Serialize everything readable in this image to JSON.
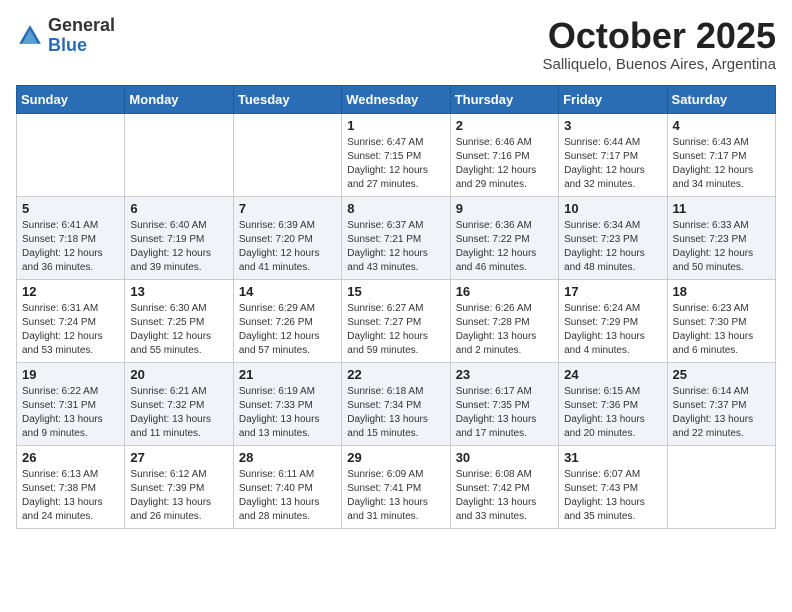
{
  "logo": {
    "general": "General",
    "blue": "Blue"
  },
  "title": "October 2025",
  "subtitle": "Salliquelo, Buenos Aires, Argentina",
  "days_header": [
    "Sunday",
    "Monday",
    "Tuesday",
    "Wednesday",
    "Thursday",
    "Friday",
    "Saturday"
  ],
  "weeks": [
    [
      {
        "day": "",
        "info": ""
      },
      {
        "day": "",
        "info": ""
      },
      {
        "day": "",
        "info": ""
      },
      {
        "day": "1",
        "info": "Sunrise: 6:47 AM\nSunset: 7:15 PM\nDaylight: 12 hours\nand 27 minutes."
      },
      {
        "day": "2",
        "info": "Sunrise: 6:46 AM\nSunset: 7:16 PM\nDaylight: 12 hours\nand 29 minutes."
      },
      {
        "day": "3",
        "info": "Sunrise: 6:44 AM\nSunset: 7:17 PM\nDaylight: 12 hours\nand 32 minutes."
      },
      {
        "day": "4",
        "info": "Sunrise: 6:43 AM\nSunset: 7:17 PM\nDaylight: 12 hours\nand 34 minutes."
      }
    ],
    [
      {
        "day": "5",
        "info": "Sunrise: 6:41 AM\nSunset: 7:18 PM\nDaylight: 12 hours\nand 36 minutes."
      },
      {
        "day": "6",
        "info": "Sunrise: 6:40 AM\nSunset: 7:19 PM\nDaylight: 12 hours\nand 39 minutes."
      },
      {
        "day": "7",
        "info": "Sunrise: 6:39 AM\nSunset: 7:20 PM\nDaylight: 12 hours\nand 41 minutes."
      },
      {
        "day": "8",
        "info": "Sunrise: 6:37 AM\nSunset: 7:21 PM\nDaylight: 12 hours\nand 43 minutes."
      },
      {
        "day": "9",
        "info": "Sunrise: 6:36 AM\nSunset: 7:22 PM\nDaylight: 12 hours\nand 46 minutes."
      },
      {
        "day": "10",
        "info": "Sunrise: 6:34 AM\nSunset: 7:23 PM\nDaylight: 12 hours\nand 48 minutes."
      },
      {
        "day": "11",
        "info": "Sunrise: 6:33 AM\nSunset: 7:23 PM\nDaylight: 12 hours\nand 50 minutes."
      }
    ],
    [
      {
        "day": "12",
        "info": "Sunrise: 6:31 AM\nSunset: 7:24 PM\nDaylight: 12 hours\nand 53 minutes."
      },
      {
        "day": "13",
        "info": "Sunrise: 6:30 AM\nSunset: 7:25 PM\nDaylight: 12 hours\nand 55 minutes."
      },
      {
        "day": "14",
        "info": "Sunrise: 6:29 AM\nSunset: 7:26 PM\nDaylight: 12 hours\nand 57 minutes."
      },
      {
        "day": "15",
        "info": "Sunrise: 6:27 AM\nSunset: 7:27 PM\nDaylight: 12 hours\nand 59 minutes."
      },
      {
        "day": "16",
        "info": "Sunrise: 6:26 AM\nSunset: 7:28 PM\nDaylight: 13 hours\nand 2 minutes."
      },
      {
        "day": "17",
        "info": "Sunrise: 6:24 AM\nSunset: 7:29 PM\nDaylight: 13 hours\nand 4 minutes."
      },
      {
        "day": "18",
        "info": "Sunrise: 6:23 AM\nSunset: 7:30 PM\nDaylight: 13 hours\nand 6 minutes."
      }
    ],
    [
      {
        "day": "19",
        "info": "Sunrise: 6:22 AM\nSunset: 7:31 PM\nDaylight: 13 hours\nand 9 minutes."
      },
      {
        "day": "20",
        "info": "Sunrise: 6:21 AM\nSunset: 7:32 PM\nDaylight: 13 hours\nand 11 minutes."
      },
      {
        "day": "21",
        "info": "Sunrise: 6:19 AM\nSunset: 7:33 PM\nDaylight: 13 hours\nand 13 minutes."
      },
      {
        "day": "22",
        "info": "Sunrise: 6:18 AM\nSunset: 7:34 PM\nDaylight: 13 hours\nand 15 minutes."
      },
      {
        "day": "23",
        "info": "Sunrise: 6:17 AM\nSunset: 7:35 PM\nDaylight: 13 hours\nand 17 minutes."
      },
      {
        "day": "24",
        "info": "Sunrise: 6:15 AM\nSunset: 7:36 PM\nDaylight: 13 hours\nand 20 minutes."
      },
      {
        "day": "25",
        "info": "Sunrise: 6:14 AM\nSunset: 7:37 PM\nDaylight: 13 hours\nand 22 minutes."
      }
    ],
    [
      {
        "day": "26",
        "info": "Sunrise: 6:13 AM\nSunset: 7:38 PM\nDaylight: 13 hours\nand 24 minutes."
      },
      {
        "day": "27",
        "info": "Sunrise: 6:12 AM\nSunset: 7:39 PM\nDaylight: 13 hours\nand 26 minutes."
      },
      {
        "day": "28",
        "info": "Sunrise: 6:11 AM\nSunset: 7:40 PM\nDaylight: 13 hours\nand 28 minutes."
      },
      {
        "day": "29",
        "info": "Sunrise: 6:09 AM\nSunset: 7:41 PM\nDaylight: 13 hours\nand 31 minutes."
      },
      {
        "day": "30",
        "info": "Sunrise: 6:08 AM\nSunset: 7:42 PM\nDaylight: 13 hours\nand 33 minutes."
      },
      {
        "day": "31",
        "info": "Sunrise: 6:07 AM\nSunset: 7:43 PM\nDaylight: 13 hours\nand 35 minutes."
      },
      {
        "day": "",
        "info": ""
      }
    ]
  ]
}
